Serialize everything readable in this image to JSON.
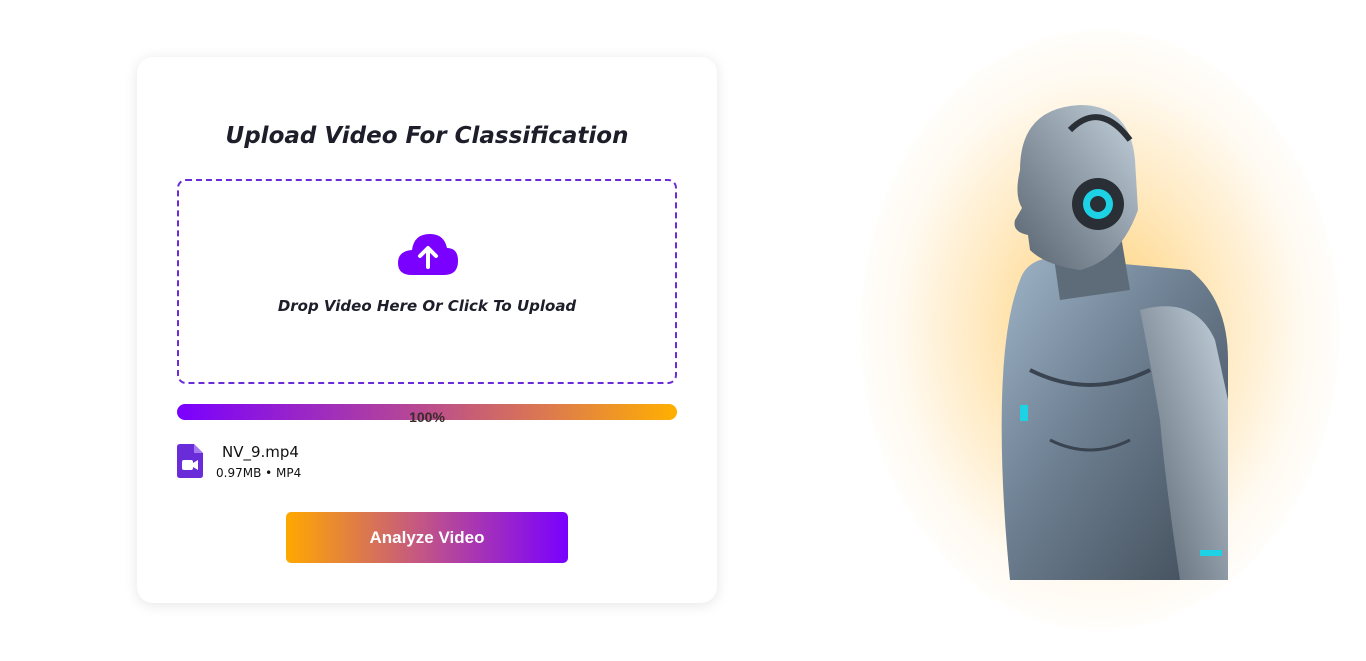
{
  "upload": {
    "title": "Upload Video For Classification",
    "dropzone_text": "Drop Video Here Or Click To Upload",
    "progress_label": "100%",
    "progress_fraction": 1.0
  },
  "file": {
    "name": "NV_9.mp4",
    "meta": "0.97MB • MP4"
  },
  "actions": {
    "analyze_label": "Analyze Video"
  },
  "icons": {
    "upload": "cloud-upload-icon",
    "file": "video-file-icon"
  },
  "colors": {
    "accent_purple": "#7a00ff",
    "accent_orange": "#ffa800",
    "dropzone_border": "#6a2bd9"
  }
}
